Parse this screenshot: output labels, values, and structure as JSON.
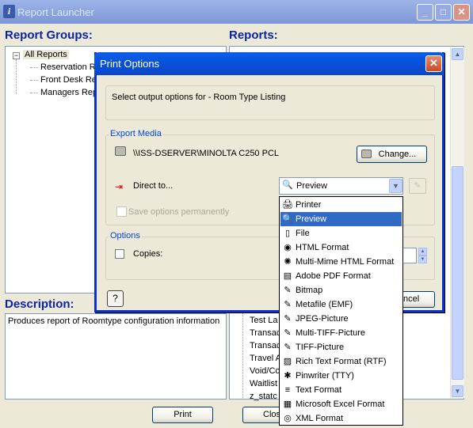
{
  "window": {
    "title": "Report Launcher",
    "app_icon": "i",
    "min_glyph": "_",
    "max_glyph": "□",
    "close_glyph": "✕"
  },
  "report_groups": {
    "heading": "Report Groups:",
    "expander": "−",
    "items": [
      "All Reports",
      "Reservation R",
      "Front Desk Re",
      "Managers Rep"
    ]
  },
  "reports": {
    "heading": "Reports:",
    "visible_items": [
      "Test La",
      "Transac",
      "Transac",
      "Travel A",
      "Void/Co",
      "Waitlist",
      "z_statc"
    ]
  },
  "description": {
    "heading": "Description:",
    "text": "Produces report of Roomtype configuration information"
  },
  "footer": {
    "print_label": "Print",
    "close_label": "Clos"
  },
  "dialog": {
    "title": "Print Options",
    "close_glyph": "✕",
    "instructions": "Select output options for - Room Type Listing",
    "export_media": {
      "group_title": "Export Media",
      "printer_name": "\\\\ISS-DSERVER\\MINOLTA C250 PCL",
      "change_label": "Change...",
      "direct_to_label": "Direct to...",
      "selected_output": "Preview",
      "save_options_label": "Save options permanently"
    },
    "options": {
      "group_title": "Options",
      "copies_label": "Copies:"
    },
    "help_glyph": "?",
    "cancel_label": "ncel"
  },
  "output_options": [
    {
      "label": "Printer",
      "icon": "printer-icon",
      "glyph": "🖨"
    },
    {
      "label": "Preview",
      "icon": "preview-icon",
      "glyph": "🔍"
    },
    {
      "label": "File",
      "icon": "file-icon",
      "glyph": "▯"
    },
    {
      "label": "HTML Format",
      "icon": "html-icon",
      "glyph": "◉"
    },
    {
      "label": "Multi-Mime HTML Format",
      "icon": "mime-icon",
      "glyph": "✺"
    },
    {
      "label": "Adobe PDF Format",
      "icon": "pdf-icon",
      "glyph": "▤"
    },
    {
      "label": "Bitmap",
      "icon": "bitmap-icon",
      "glyph": "✎"
    },
    {
      "label": "Metafile (EMF)",
      "icon": "metafile-icon",
      "glyph": "✎"
    },
    {
      "label": "JPEG-Picture",
      "icon": "jpeg-icon",
      "glyph": "✎"
    },
    {
      "label": "Multi-TIFF-Picture",
      "icon": "multi-tiff-icon",
      "glyph": "✎"
    },
    {
      "label": "TIFF-Picture",
      "icon": "tiff-icon",
      "glyph": "✎"
    },
    {
      "label": "Rich Text Format (RTF)",
      "icon": "rtf-icon",
      "glyph": "▨"
    },
    {
      "label": "Pinwriter (TTY)",
      "icon": "pinwriter-icon",
      "glyph": "✱"
    },
    {
      "label": "Text Format",
      "icon": "text-icon",
      "glyph": "≡"
    },
    {
      "label": "Microsoft Excel Format",
      "icon": "excel-icon",
      "glyph": "▦"
    },
    {
      "label": "XML Format",
      "icon": "xml-icon",
      "glyph": "◎"
    }
  ],
  "selected_output_index": 1,
  "colors": {
    "selection": "#316ac5",
    "heading": "#0b24a6",
    "dialog_title": "#0a5ee9"
  }
}
